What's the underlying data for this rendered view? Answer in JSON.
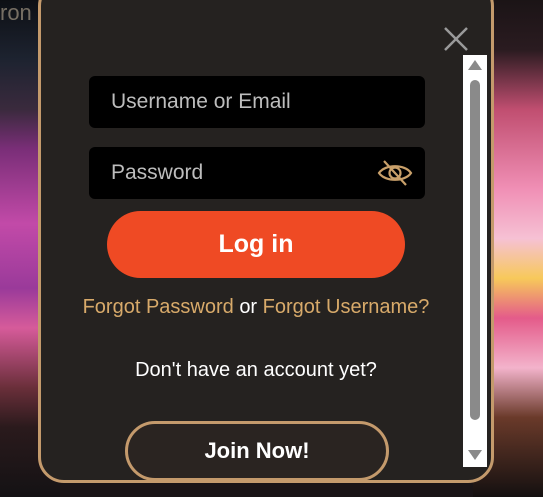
{
  "background": {
    "top_left_text": "ron"
  },
  "login": {
    "username_placeholder": "Username or Email",
    "password_placeholder": "Password",
    "login_label": "Log in",
    "forgot_password_label": "Forgot Password",
    "or_text": "or",
    "forgot_username_label": "Forgot Username?",
    "no_account_text": "Don't have an account yet?",
    "join_label": "Join Now!"
  },
  "icons": {
    "close": "close-icon",
    "eye": "eye-slash-icon",
    "scroll_up": "triangle-up-icon",
    "scroll_down": "triangle-down-icon"
  },
  "colors": {
    "accent": "#ef4a24",
    "gold": "#c49a6c",
    "link": "#d8aa6a",
    "modal_bg": "#252220"
  }
}
